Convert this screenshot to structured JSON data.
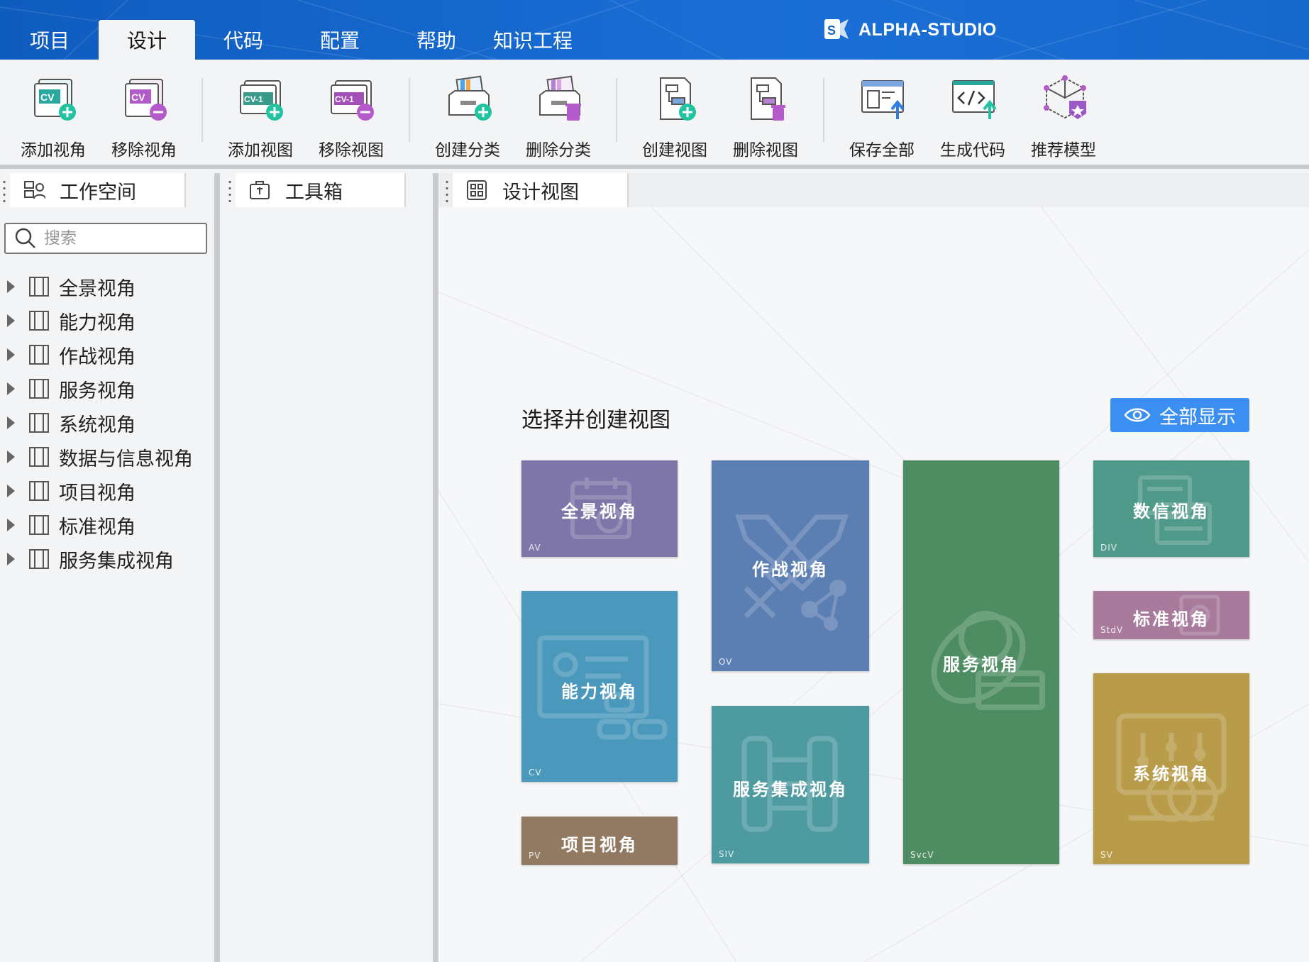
{
  "brand": {
    "name": "ALPHA-STUDIO"
  },
  "menu": {
    "tabs": [
      {
        "label": "项目"
      },
      {
        "label": "设计",
        "active": true
      },
      {
        "label": "代码"
      },
      {
        "label": "配置"
      },
      {
        "label": "帮助"
      },
      {
        "label": "知识工程"
      }
    ]
  },
  "toolbar": {
    "buttons": [
      {
        "label": "添加视角",
        "icon": "add-viewpoint-icon",
        "badge": "CV"
      },
      {
        "label": "移除视角",
        "icon": "remove-viewpoint-icon",
        "badge": "CV"
      },
      {
        "label": "添加视图",
        "icon": "add-view-icon",
        "badge": "CV-1"
      },
      {
        "label": "移除视图",
        "icon": "remove-view-icon",
        "badge": "CV-1"
      },
      {
        "label": "创建分类",
        "icon": "create-category-icon"
      },
      {
        "label": "删除分类",
        "icon": "delete-category-icon"
      },
      {
        "label": "创建视图",
        "icon": "create-diagram-icon"
      },
      {
        "label": "删除视图",
        "icon": "delete-diagram-icon"
      },
      {
        "label": "保存全部",
        "icon": "save-all-icon"
      },
      {
        "label": "生成代码",
        "icon": "generate-code-icon"
      },
      {
        "label": "推荐模型",
        "icon": "recommend-model-icon"
      }
    ]
  },
  "workspace": {
    "title": "工作空间",
    "search_placeholder": "搜索",
    "tree": [
      {
        "label": "全景视角"
      },
      {
        "label": "能力视角"
      },
      {
        "label": "作战视角"
      },
      {
        "label": "服务视角"
      },
      {
        "label": "系统视角"
      },
      {
        "label": "数据与信息视角"
      },
      {
        "label": "项目视角"
      },
      {
        "label": "标准视角"
      },
      {
        "label": "服务集成视角"
      }
    ]
  },
  "toolbox": {
    "title": "工具箱"
  },
  "design": {
    "tab_title": "设计视图",
    "heading": "选择并创建视图",
    "show_all_label": "全部显示",
    "cards": [
      {
        "title": "全景视角",
        "abbr": "AV",
        "color": "#7e75a8"
      },
      {
        "title": "能力视角",
        "abbr": "CV",
        "color": "#4a98bb"
      },
      {
        "title": "项目视角",
        "abbr": "PV",
        "color": "#927a62"
      },
      {
        "title": "作战视角",
        "abbr": "OV",
        "color": "#5b7eb3"
      },
      {
        "title": "服务集成视角",
        "abbr": "SIV",
        "color": "#4d9aa1"
      },
      {
        "title": "服务视角",
        "abbr": "SvcV",
        "color": "#4e8c62"
      },
      {
        "title": "数信视角",
        "abbr": "DIV",
        "color": "#4f998a"
      },
      {
        "title": "标准视角",
        "abbr": "StdV",
        "color": "#a87a9c"
      },
      {
        "title": "系统视角",
        "abbr": "SV",
        "color": "#b99c4a"
      }
    ]
  }
}
